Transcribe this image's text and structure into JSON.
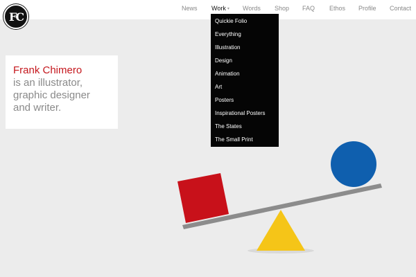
{
  "logo": {
    "text": "FC"
  },
  "nav": {
    "items": [
      {
        "label": "News",
        "active": false
      },
      {
        "label": "Work",
        "active": true,
        "chevron": "▾"
      },
      {
        "label": "Words",
        "active": false
      },
      {
        "label": "Shop",
        "active": false
      },
      {
        "label": "FAQ",
        "active": false
      },
      {
        "label": "Ethos",
        "active": false
      },
      {
        "label": "Profile",
        "active": false
      },
      {
        "label": "Contact",
        "active": false
      }
    ]
  },
  "dropdown": {
    "items": [
      "Quickie Folio",
      "Everything",
      "Illustration",
      "Design",
      "Animation",
      "Art",
      "Posters",
      "Inspirational Posters",
      "The States",
      "The Small Print"
    ]
  },
  "intro": {
    "name": "Frank Chimero",
    "lines": [
      "is an illustrator,",
      "graphic designer",
      "and writer."
    ]
  },
  "colors": {
    "brand_red": "#c4161c",
    "square_red": "#c8111a",
    "circle_blue": "#0f5fae",
    "triangle_yellow": "#f5c518",
    "plank_gray": "#8c8c8c"
  }
}
